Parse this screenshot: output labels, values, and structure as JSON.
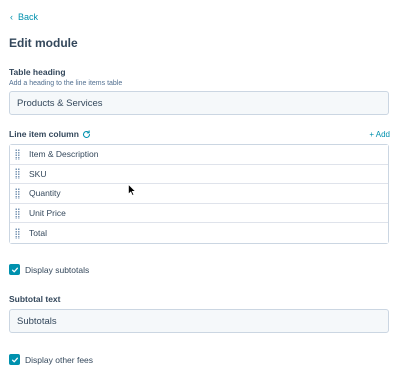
{
  "nav": {
    "back_label": "Back"
  },
  "page": {
    "title": "Edit module"
  },
  "table_heading": {
    "label": "Table heading",
    "help": "Add a heading to the line items table",
    "value": "Products & Services"
  },
  "line_item_column": {
    "label": "Line item column",
    "add_label": "+ Add",
    "items": [
      "Item & Description",
      "SKU",
      "Quantity",
      "Unit Price",
      "Total"
    ]
  },
  "display_subtotals": {
    "label": "Display subtotals",
    "checked": true
  },
  "subtotal_text": {
    "label": "Subtotal text",
    "value": "Subtotals"
  },
  "display_other_fees": {
    "label": "Display other fees",
    "checked": true
  },
  "colors": {
    "accent": "#0091ae",
    "text": "#33475b",
    "input_bg": "#f5f8fa",
    "border": "#cbd6e2"
  }
}
